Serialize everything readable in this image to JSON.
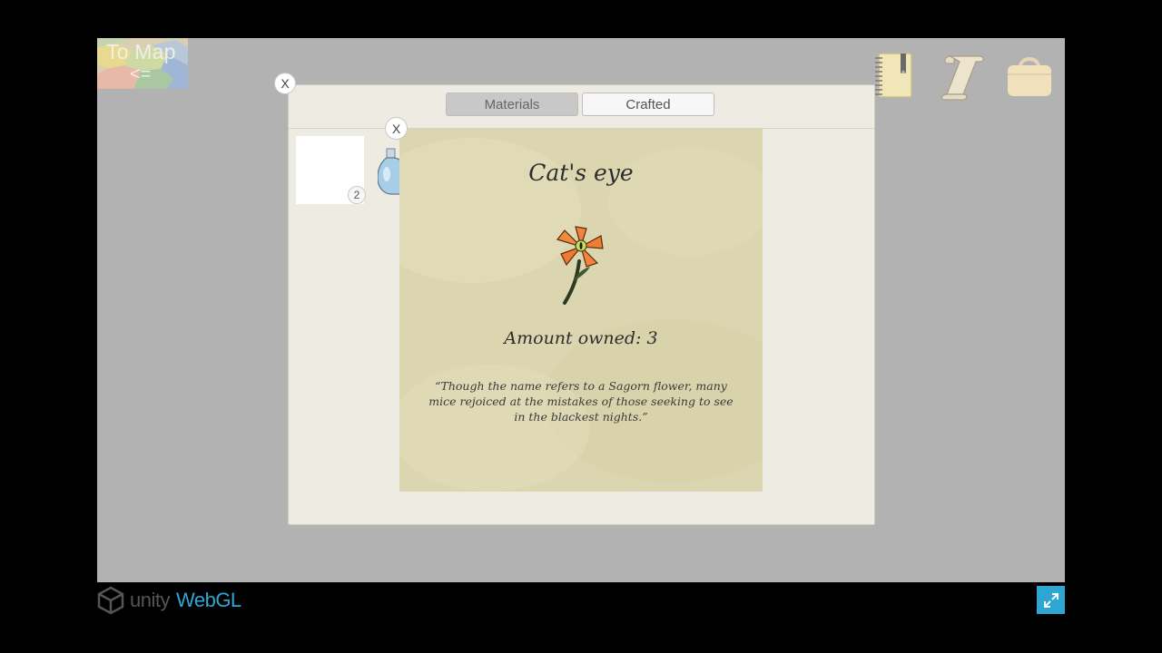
{
  "to_map": {
    "label": "To Map",
    "arrow": "<="
  },
  "inventory": {
    "tabs": [
      {
        "label": "Materials",
        "active": true
      },
      {
        "label": "Crafted",
        "active": false
      }
    ],
    "close_label": "X",
    "slots": [
      {
        "count": "2"
      }
    ]
  },
  "detail": {
    "close_label": "X",
    "title": "Cat's eye",
    "amount": "Amount owned: 3",
    "description": "“Though the name refers to a Sagorn flower, many mice rejoiced at the mistakes of those seeking to see in the blackest nights.”",
    "icon": "cats-eye-flower-icon"
  },
  "top_icons": [
    "journal-icon",
    "quest-scroll-icon",
    "bag-icon"
  ],
  "footer": {
    "brand": "unity",
    "product": "WebGL"
  },
  "colors": {
    "game_bg": "#b2b2b2",
    "panel_bg": "#eeebe3",
    "parchment": "#dcd6b0",
    "accent": "#2ea6d4"
  }
}
